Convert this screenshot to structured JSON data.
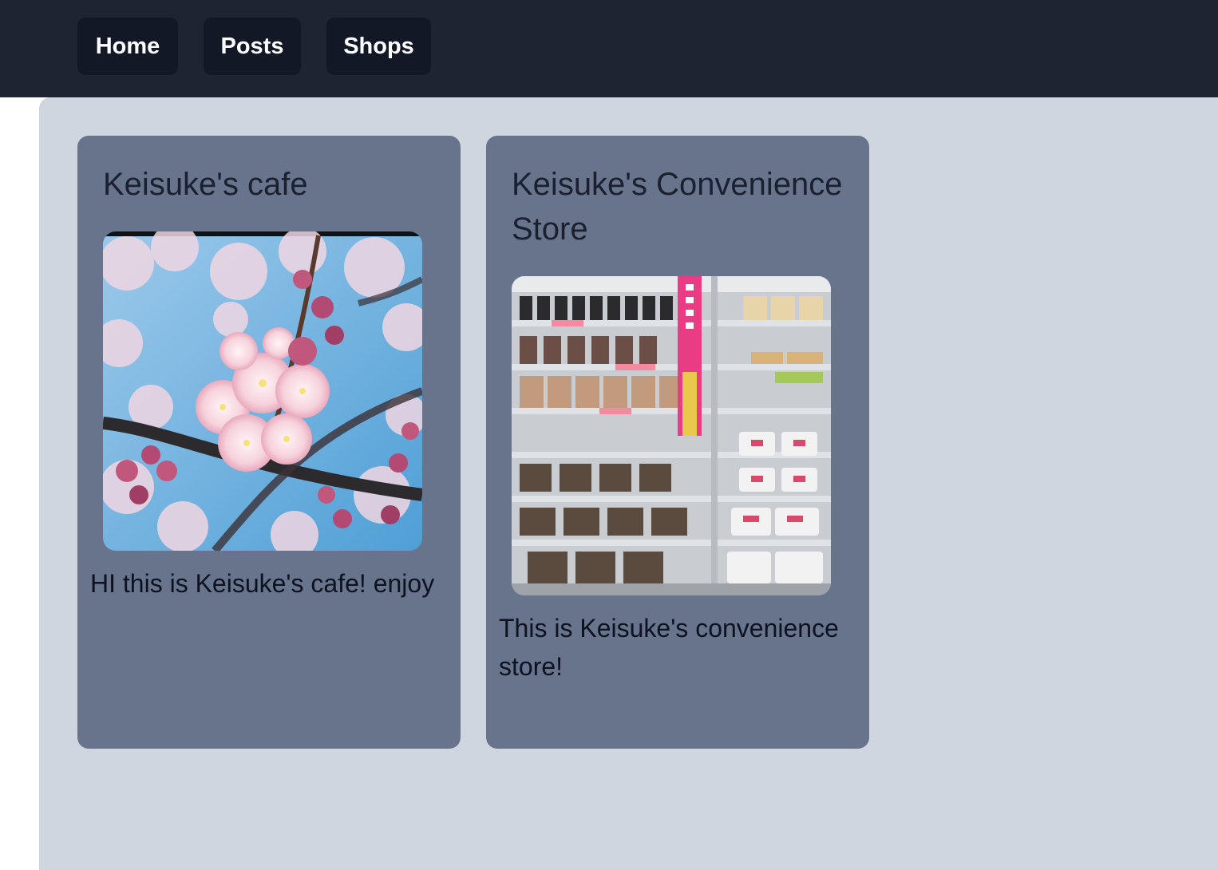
{
  "nav": {
    "home": "Home",
    "posts": "Posts",
    "shops": "Shops"
  },
  "shops": [
    {
      "title": "Keisuke's cafe",
      "description": "HI this is Keisuke's cafe! enjoy",
      "image": "cherry-blossom-photo"
    },
    {
      "title": "Keisuke's Convenience Store",
      "description": "This is Keisuke's convenience store!",
      "image": "convenience-store-shelves-photo"
    }
  ],
  "colors": {
    "topbar": "#1f2433",
    "nav_button": "#131826",
    "content_bg": "#cfd6e0",
    "card_bg": "#67748b"
  }
}
